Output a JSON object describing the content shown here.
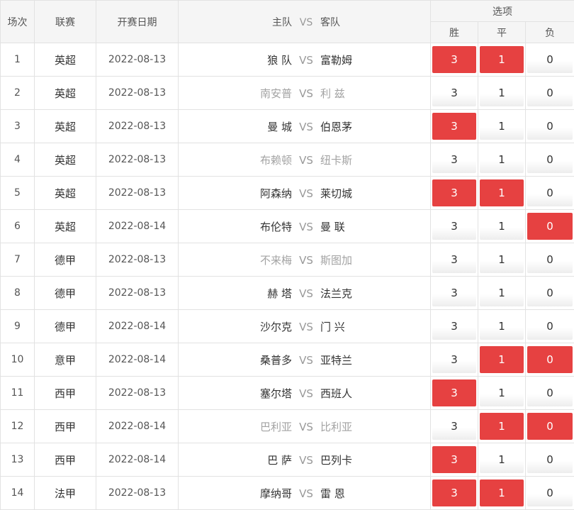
{
  "header": {
    "col_num": "场次",
    "col_league": "联赛",
    "col_date": "开赛日期",
    "col_home": "主队",
    "col_vs": "VS",
    "col_away": "客队",
    "col_options": "选项",
    "opt_win": "胜",
    "opt_draw": "平",
    "opt_lose": "负"
  },
  "colors": {
    "selected": "#e64141",
    "muted": "#a3a3a3"
  },
  "rows": [
    {
      "num": "1",
      "league": "英超",
      "date": "2022-08-13",
      "home": "狼 队",
      "vs": "VS",
      "away": "富勒姆",
      "muted": false,
      "win": "3",
      "draw": "1",
      "lose": "0",
      "sel": [
        true,
        true,
        false
      ]
    },
    {
      "num": "2",
      "league": "英超",
      "date": "2022-08-13",
      "home": "南安普",
      "vs": "VS",
      "away": "利 兹",
      "muted": true,
      "win": "3",
      "draw": "1",
      "lose": "0",
      "sel": [
        false,
        false,
        false
      ]
    },
    {
      "num": "3",
      "league": "英超",
      "date": "2022-08-13",
      "home": "曼 城",
      "vs": "VS",
      "away": "伯恩茅",
      "muted": false,
      "win": "3",
      "draw": "1",
      "lose": "0",
      "sel": [
        true,
        false,
        false
      ]
    },
    {
      "num": "4",
      "league": "英超",
      "date": "2022-08-13",
      "home": "布赖顿",
      "vs": "VS",
      "away": "纽卡斯",
      "muted": true,
      "win": "3",
      "draw": "1",
      "lose": "0",
      "sel": [
        false,
        false,
        false
      ]
    },
    {
      "num": "5",
      "league": "英超",
      "date": "2022-08-13",
      "home": "阿森纳",
      "vs": "VS",
      "away": "莱切城",
      "muted": false,
      "win": "3",
      "draw": "1",
      "lose": "0",
      "sel": [
        true,
        true,
        false
      ]
    },
    {
      "num": "6",
      "league": "英超",
      "date": "2022-08-14",
      "home": "布伦特",
      "vs": "VS",
      "away": "曼 联",
      "muted": false,
      "win": "3",
      "draw": "1",
      "lose": "0",
      "sel": [
        false,
        false,
        true
      ]
    },
    {
      "num": "7",
      "league": "德甲",
      "date": "2022-08-13",
      "home": "不来梅",
      "vs": "VS",
      "away": "斯图加",
      "muted": true,
      "win": "3",
      "draw": "1",
      "lose": "0",
      "sel": [
        false,
        false,
        false
      ]
    },
    {
      "num": "8",
      "league": "德甲",
      "date": "2022-08-13",
      "home": "赫 塔",
      "vs": "VS",
      "away": "法兰克",
      "muted": false,
      "win": "3",
      "draw": "1",
      "lose": "0",
      "sel": [
        false,
        false,
        false
      ]
    },
    {
      "num": "9",
      "league": "德甲",
      "date": "2022-08-14",
      "home": "沙尔克",
      "vs": "VS",
      "away": "门 兴",
      "muted": false,
      "win": "3",
      "draw": "1",
      "lose": "0",
      "sel": [
        false,
        false,
        false
      ]
    },
    {
      "num": "10",
      "league": "意甲",
      "date": "2022-08-14",
      "home": "桑普多",
      "vs": "VS",
      "away": "亚特兰",
      "muted": false,
      "win": "3",
      "draw": "1",
      "lose": "0",
      "sel": [
        false,
        true,
        true
      ]
    },
    {
      "num": "11",
      "league": "西甲",
      "date": "2022-08-13",
      "home": "塞尔塔",
      "vs": "VS",
      "away": "西班人",
      "muted": false,
      "win": "3",
      "draw": "1",
      "lose": "0",
      "sel": [
        true,
        false,
        false
      ]
    },
    {
      "num": "12",
      "league": "西甲",
      "date": "2022-08-14",
      "home": "巴利亚",
      "vs": "VS",
      "away": "比利亚",
      "muted": true,
      "win": "3",
      "draw": "1",
      "lose": "0",
      "sel": [
        false,
        true,
        true
      ]
    },
    {
      "num": "13",
      "league": "西甲",
      "date": "2022-08-14",
      "home": "巴 萨",
      "vs": "VS",
      "away": "巴列卡",
      "muted": false,
      "win": "3",
      "draw": "1",
      "lose": "0",
      "sel": [
        true,
        false,
        false
      ]
    },
    {
      "num": "14",
      "league": "法甲",
      "date": "2022-08-13",
      "home": "摩纳哥",
      "vs": "VS",
      "away": "雷 恩",
      "muted": false,
      "win": "3",
      "draw": "1",
      "lose": "0",
      "sel": [
        true,
        true,
        false
      ]
    }
  ]
}
